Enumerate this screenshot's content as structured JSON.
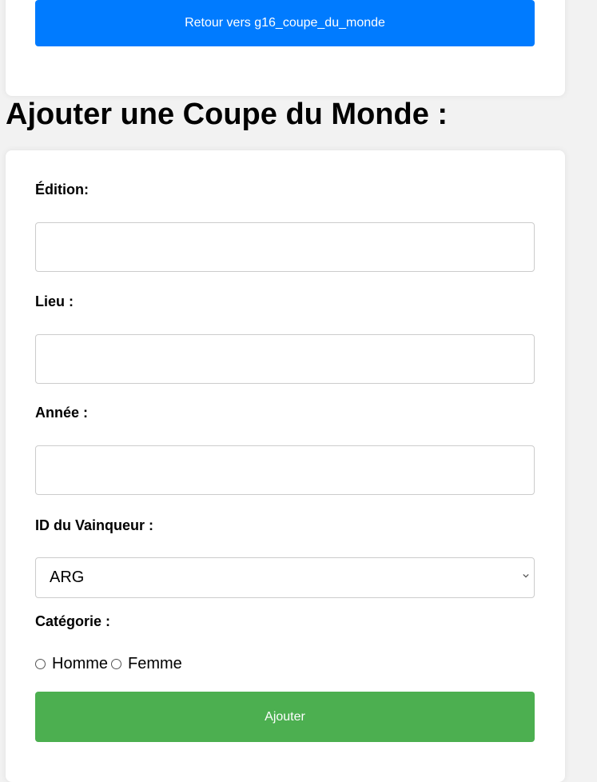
{
  "top_card": {
    "back_button_label": "Retour vers g16_coupe_du_monde"
  },
  "page_title": "Ajouter une Coupe du Monde :",
  "form": {
    "edition_label": "Édition:",
    "edition_value": "",
    "lieu_label": "Lieu :",
    "lieu_value": "",
    "annee_label": "Année :",
    "annee_value": "",
    "vainqueur_label": "ID du Vainqueur :",
    "vainqueur_selected": "ARG",
    "categorie_label": "Catégorie :",
    "categorie_options": [
      "Homme",
      "Femme"
    ],
    "submit_label": "Ajouter"
  },
  "colors": {
    "back_button": "#007bff",
    "submit_button": "#4caf50",
    "background": "#f2f2f2"
  }
}
